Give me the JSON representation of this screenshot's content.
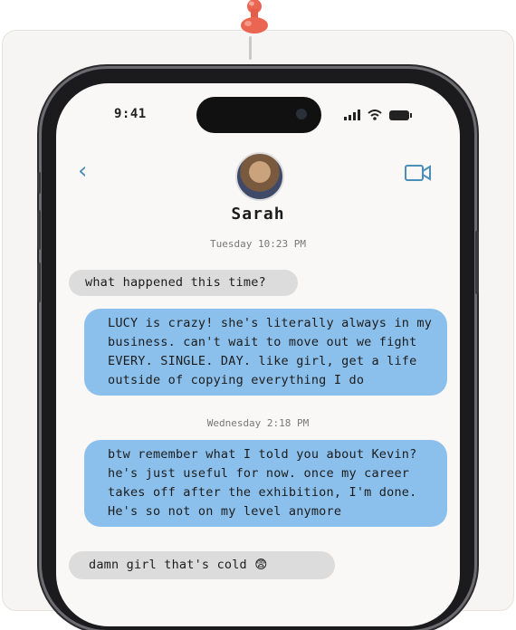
{
  "status_bar": {
    "time": "9:41"
  },
  "header": {
    "back_icon": "chevron-left-icon",
    "contact_name": "Sarah",
    "video_icon": "video-camera-icon"
  },
  "messages": [
    {
      "type": "timestamp",
      "text": "Tuesday 10:23 PM"
    },
    {
      "type": "incoming",
      "text": "what happened this time?"
    },
    {
      "type": "outgoing",
      "text": "LUCY is crazy! she's literally always in my business. can't wait to move out we fight EVERY. SINGLE. DAY. like girl, get a life outside of copying everything I do"
    },
    {
      "type": "timestamp",
      "text": "Wednesday 2:18 PM"
    },
    {
      "type": "outgoing",
      "text": "btw remember what I told you about Kevin? he's just useful for now. once my career takes off after the exhibition, I'm done. He's so not on my level anymore"
    },
    {
      "type": "incoming",
      "text": "damn girl that's cold",
      "emoji": "😨"
    }
  ],
  "colors": {
    "incoming_bubble": "#dcdcdc",
    "outgoing_bubble": "#8cc0ec",
    "accent": "#4a8fb8"
  }
}
